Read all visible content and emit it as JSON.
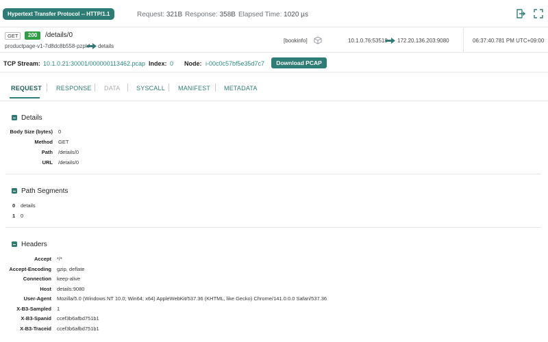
{
  "header": {
    "protocol": "Hypertext Transfer Protocol -- HTTP/1.1",
    "request_label": "Request:",
    "request_value": "321B",
    "response_label": "Response:",
    "response_value": "358B",
    "elapsed_label": "Elapsed Time:",
    "elapsed_value": "1020 µs"
  },
  "request": {
    "method": "GET",
    "status": "200",
    "path": "/details/0",
    "source_pod": "productpage-v1-7d8dc8b558-pzpkf",
    "dest_service": "details",
    "namespace": "[bookinfo]",
    "src_addr": "10.1.0.76:53518",
    "dst_addr": "172.20.136.203:9080",
    "timestamp": "06:37:40.781 PM UTC+09:00"
  },
  "stream": {
    "tcp_label": "TCP Stream:",
    "tcp_value": "10.1.0.21:30001/000000113462.pcap",
    "index_label": "Index:",
    "index_value": "0",
    "node_label": "Node:",
    "node_value": "i-00c0c57bf5e35d7c7",
    "download_label": "Download PCAP"
  },
  "tabs": [
    "REQUEST",
    "RESPONSE",
    "DATA",
    "SYSCALL",
    "MANIFEST",
    "METADATA"
  ],
  "details": {
    "title": "Details",
    "rows": [
      {
        "key": "Body Size (bytes)",
        "value": "0"
      },
      {
        "key": "Method",
        "value": "GET"
      },
      {
        "key": "Path",
        "value": "/details/0"
      },
      {
        "key": "URL",
        "value": "/details/0"
      }
    ]
  },
  "path_segments": {
    "title": "Path Segments",
    "rows": [
      {
        "key": "0",
        "value": "details"
      },
      {
        "key": "1",
        "value": "0"
      }
    ]
  },
  "headers": {
    "title": "Headers",
    "rows": [
      {
        "key": "Accept",
        "value": "*/*"
      },
      {
        "key": "Accept-Encoding",
        "value": "gzip, deflate"
      },
      {
        "key": "Connection",
        "value": "keep-alive"
      },
      {
        "key": "Host",
        "value": "details:9080"
      },
      {
        "key": "User-Agent",
        "value": "Mozilla/5.0 (Windows NT 10.0; Win64; x64) AppleWebKit/537.36 (KHTML, like Gecko) Chrome/141.0.0.0 Safari/537.36"
      },
      {
        "key": "X-B3-Sampled",
        "value": "1"
      },
      {
        "key": "X-B3-Spanid",
        "value": "ccef3b6afbd751b1"
      },
      {
        "key": "X-B3-Traceid",
        "value": "ccef3b6afbd751b1"
      }
    ]
  },
  "colors": {
    "accent": "#2e7d74",
    "status_ok": "#2e9d44"
  },
  "icons": [
    "export-icon",
    "expand-icon",
    "arrow-right-icon",
    "cube-icon"
  ]
}
